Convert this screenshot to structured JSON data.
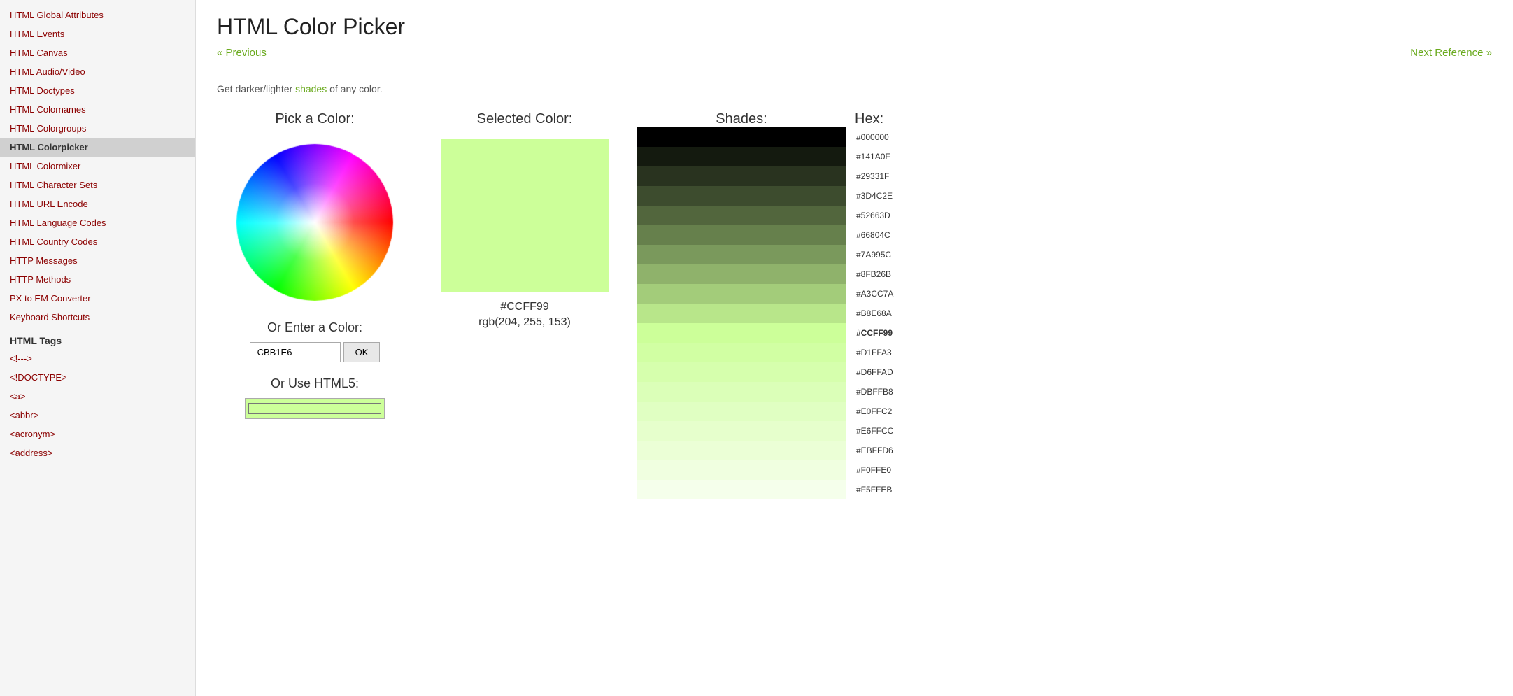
{
  "sidebar": {
    "items_top": [
      {
        "label": "HTML Global Attributes",
        "active": false
      },
      {
        "label": "HTML Events",
        "active": false
      },
      {
        "label": "HTML Canvas",
        "active": false
      },
      {
        "label": "HTML Audio/Video",
        "active": false
      },
      {
        "label": "HTML Doctypes",
        "active": false
      },
      {
        "label": "HTML Colornames",
        "active": false
      },
      {
        "label": "HTML Colorgroups",
        "active": false
      },
      {
        "label": "HTML Colorpicker",
        "active": true
      },
      {
        "label": "HTML Colormixer",
        "active": false
      },
      {
        "label": "HTML Character Sets",
        "active": false
      },
      {
        "label": "HTML URL Encode",
        "active": false
      },
      {
        "label": "HTML Language Codes",
        "active": false
      },
      {
        "label": "HTML Country Codes",
        "active": false
      },
      {
        "label": "HTTP Messages",
        "active": false
      },
      {
        "label": "HTTP Methods",
        "active": false
      },
      {
        "label": "PX to EM Converter",
        "active": false
      },
      {
        "label": "Keyboard Shortcuts",
        "active": false
      }
    ],
    "html_tags_title": "HTML Tags",
    "items_tags": [
      {
        "label": "<!--->",
        "active": false
      },
      {
        "label": "<!DOCTYPE>",
        "active": false
      },
      {
        "label": "<a>",
        "active": false
      },
      {
        "label": "<abbr>",
        "active": false
      },
      {
        "label": "<acronym>",
        "active": false
      },
      {
        "label": "<address>",
        "active": false
      }
    ]
  },
  "main": {
    "title": "HTML Color Picker",
    "nav": {
      "prev_label": "« Previous",
      "next_label": "Next Reference »"
    },
    "description": "Get darker/lighter shades of any color.",
    "pick_color_label": "Pick a Color:",
    "enter_color_label": "Or Enter a Color:",
    "color_input_value": "CBB1E6",
    "ok_label": "OK",
    "html5_label": "Or Use HTML5:",
    "selected_color_label": "Selected Color:",
    "shades_label": "Shades:",
    "hex_label": "Hex:",
    "selected_hex": "#CCFF99",
    "selected_rgb": "rgb(204, 255, 153)",
    "selected_color_bg": "#ccff99",
    "shades": [
      {
        "color": "#000000",
        "hex": "#000000",
        "selected": false
      },
      {
        "color": "#141A0F",
        "hex": "#141A0F",
        "selected": false
      },
      {
        "color": "#29331F",
        "hex": "#29331F",
        "selected": false
      },
      {
        "color": "#3D4C2E",
        "hex": "#3D4C2E",
        "selected": false
      },
      {
        "color": "#52663D",
        "hex": "#52663D",
        "selected": false
      },
      {
        "color": "#66804C",
        "hex": "#66804C",
        "selected": false
      },
      {
        "color": "#7A995C",
        "hex": "#7A995C",
        "selected": false
      },
      {
        "color": "#8FB26B",
        "hex": "#8FB26B",
        "selected": false
      },
      {
        "color": "#A3CC7A",
        "hex": "#A3CC7A",
        "selected": false
      },
      {
        "color": "#B8E68A",
        "hex": "#B8E68A",
        "selected": false
      },
      {
        "color": "#CCFF99",
        "hex": "#CCFF99",
        "selected": true
      },
      {
        "color": "#D1FFA3",
        "hex": "#D1FFA3",
        "selected": false
      },
      {
        "color": "#D6FFAD",
        "hex": "#D6FFAD",
        "selected": false
      },
      {
        "color": "#DBFFB8",
        "hex": "#DBFFB8",
        "selected": false
      },
      {
        "color": "#E0FFC2",
        "hex": "#E0FFC2",
        "selected": false
      },
      {
        "color": "#E6FFCC",
        "hex": "#E6FFCC",
        "selected": false
      },
      {
        "color": "#EBFFD6",
        "hex": "#EBFFD6",
        "selected": false
      },
      {
        "color": "#F0FFE0",
        "hex": "#F0FFE0",
        "selected": false
      },
      {
        "color": "#F5FFEB",
        "hex": "#F5FFEB",
        "selected": false
      }
    ]
  }
}
